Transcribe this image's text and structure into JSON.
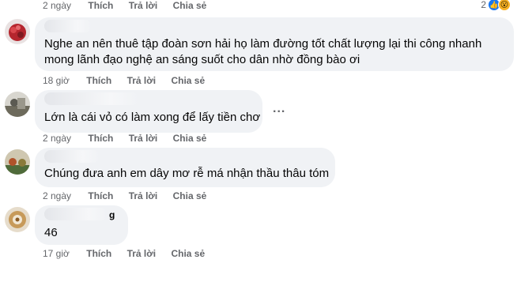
{
  "top_actions": {
    "time": "2 ngày",
    "like": "Thích",
    "reply": "Trả lời",
    "share": "Chia sẻ"
  },
  "top_reactions": {
    "count": "2",
    "icons": [
      "like-icon",
      "wow-icon"
    ]
  },
  "comments": [
    {
      "author": "",
      "lines": [
        "Nghe an nên thuê tập đoàn sơn hải họ làm đường tốt chất lượng lại thi công nhanh",
        "mong lãnh đạo nghệ an sáng suốt cho dân nhờ đồng bào ơi"
      ],
      "time": "18 giờ",
      "like": "Thích",
      "reply": "Trả lời",
      "share": "Chia sẻ"
    },
    {
      "author": "",
      "lines": [
        "Lớn là cái vỏ có làm xong để lấy tiền chơ"
      ],
      "more_label": "...",
      "time": "2 ngày",
      "like": "Thích",
      "reply": "Trả lời",
      "share": "Chia sẻ"
    },
    {
      "author": "",
      "lines": [
        "Chúng đưa anh em dây mơ rễ má nhận thầu thâu tóm"
      ],
      "time": "2 ngày",
      "like": "Thích",
      "reply": "Trả lời",
      "share": "Chia sẻ"
    },
    {
      "author": "g",
      "lines": [
        "46"
      ],
      "time": "17 giờ",
      "like": "Thích",
      "reply": "Trả lời",
      "share": "Chia sẻ"
    }
  ]
}
